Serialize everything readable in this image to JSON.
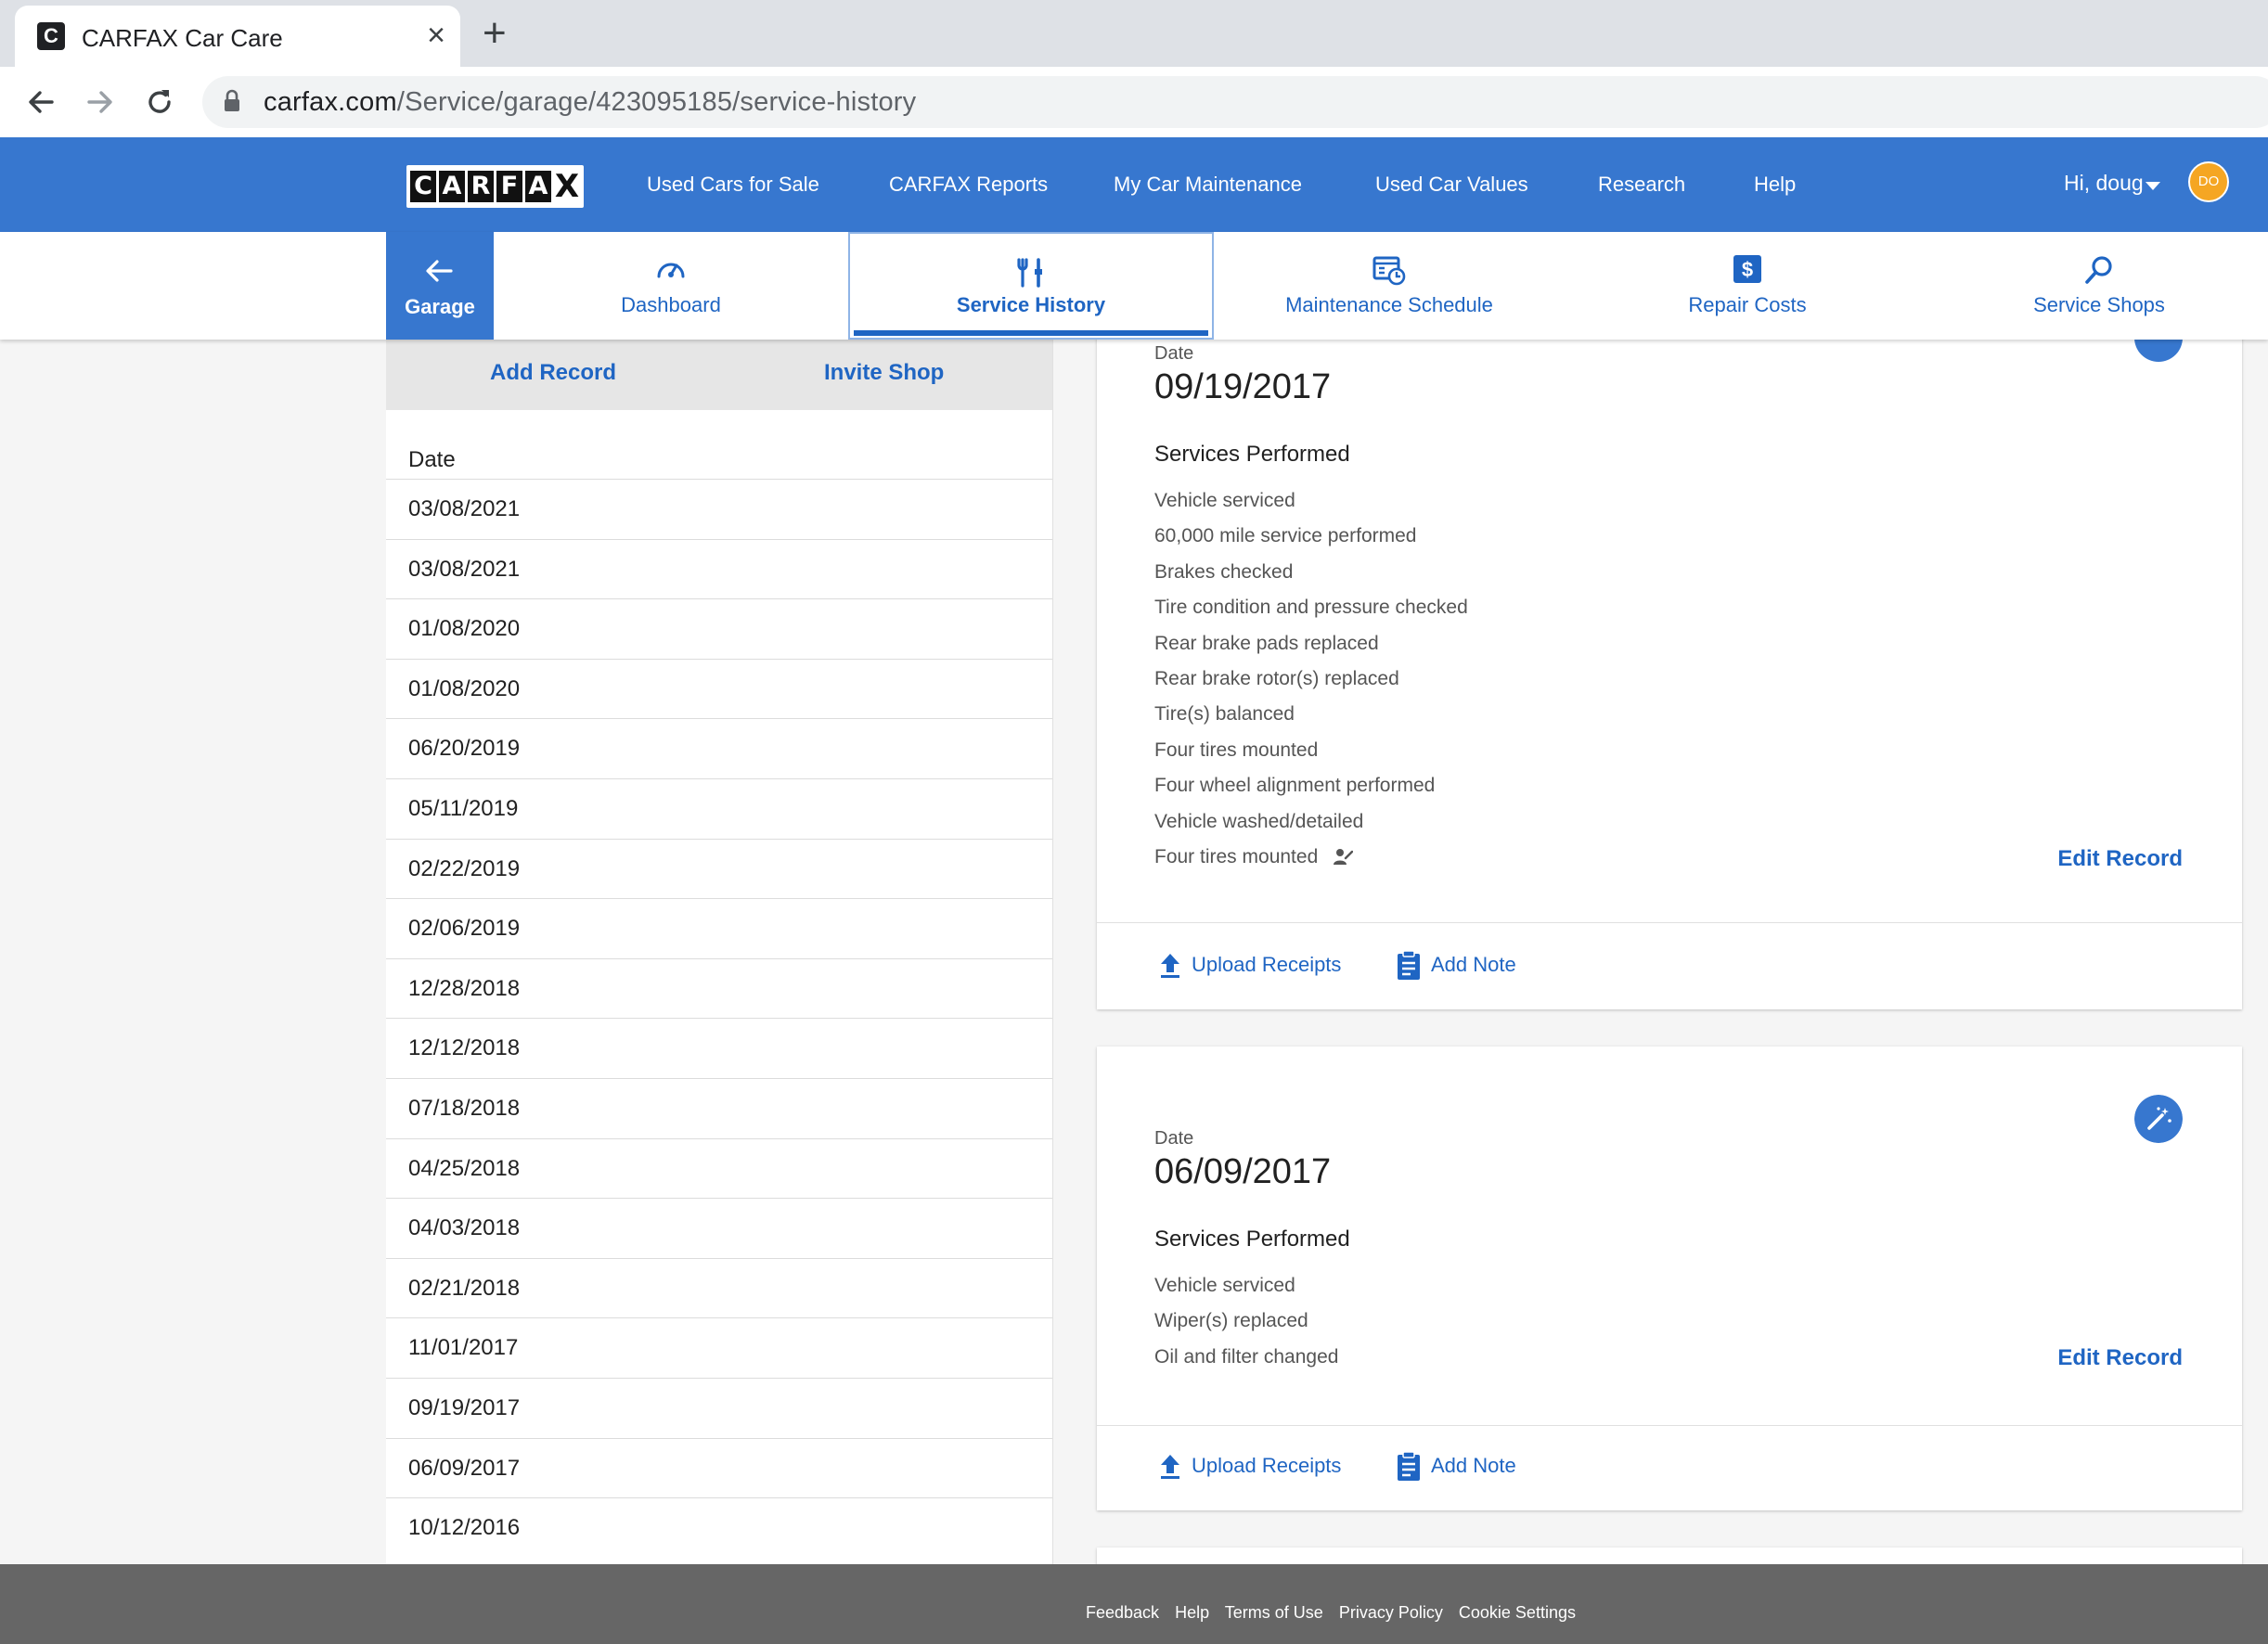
{
  "browser": {
    "tab_title": "CARFAX Car Care",
    "favicon_letter": "C",
    "url_host": "carfax.com",
    "url_path": "/Service/garage/423095185/service-history"
  },
  "header": {
    "logo_letters": [
      "C",
      "A",
      "R",
      "F",
      "A",
      "X"
    ],
    "nav": [
      "Used Cars for Sale",
      "CARFAX Reports",
      "My Car Maintenance",
      "Used Car Values",
      "Research",
      "Help"
    ],
    "greeting": "Hi, doug",
    "avatar_initials": "DO",
    "brand_color": "#3777cf",
    "avatar_color": "#f5a623"
  },
  "subnav": {
    "garage": "Garage",
    "tabs": [
      {
        "label": "Dashboard",
        "icon": "speedometer-icon"
      },
      {
        "label": "Service History",
        "icon": "wrench-icon"
      },
      {
        "label": "Maintenance Schedule",
        "icon": "calendar-clock-icon"
      },
      {
        "label": "Repair Costs",
        "icon": "dollar-icon"
      },
      {
        "label": "Service Shops",
        "icon": "search-icon"
      }
    ],
    "active_tab": "Service History"
  },
  "left_panel": {
    "add_record": "Add Record",
    "invite_shop": "Invite Shop",
    "date_header": "Date",
    "dates": [
      "03/08/2021",
      "03/08/2021",
      "01/08/2020",
      "01/08/2020",
      "06/20/2019",
      "05/11/2019",
      "02/22/2019",
      "02/06/2019",
      "12/28/2018",
      "12/12/2018",
      "07/18/2018",
      "04/25/2018",
      "04/03/2018",
      "02/21/2018",
      "11/01/2017",
      "09/19/2017",
      "06/09/2017",
      "10/12/2016"
    ]
  },
  "records": [
    {
      "date_label": "Date",
      "date": "09/19/2017",
      "services_header": "Services Performed",
      "services": [
        "Vehicle serviced",
        "60,000 mile service performed",
        "Brakes checked",
        "Tire condition and pressure checked",
        "Rear brake pads replaced",
        "Rear brake rotor(s) replaced",
        "Tire(s) balanced",
        "Four tires mounted",
        "Four wheel alignment performed",
        "Vehicle washed/detailed",
        "Four tires mounted"
      ],
      "edit": "Edit Record",
      "upload": "Upload Receipts",
      "add_note": "Add Note"
    },
    {
      "date_label": "Date",
      "date": "06/09/2017",
      "services_header": "Services Performed",
      "services": [
        "Vehicle serviced",
        "Wiper(s) replaced",
        "Oil and filter changed"
      ],
      "edit": "Edit Record",
      "upload": "Upload Receipts",
      "add_note": "Add Note"
    }
  ],
  "footer": {
    "links": [
      "Feedback",
      "Help",
      "Terms of Use",
      "Privacy Policy",
      "Cookie Settings"
    ]
  }
}
